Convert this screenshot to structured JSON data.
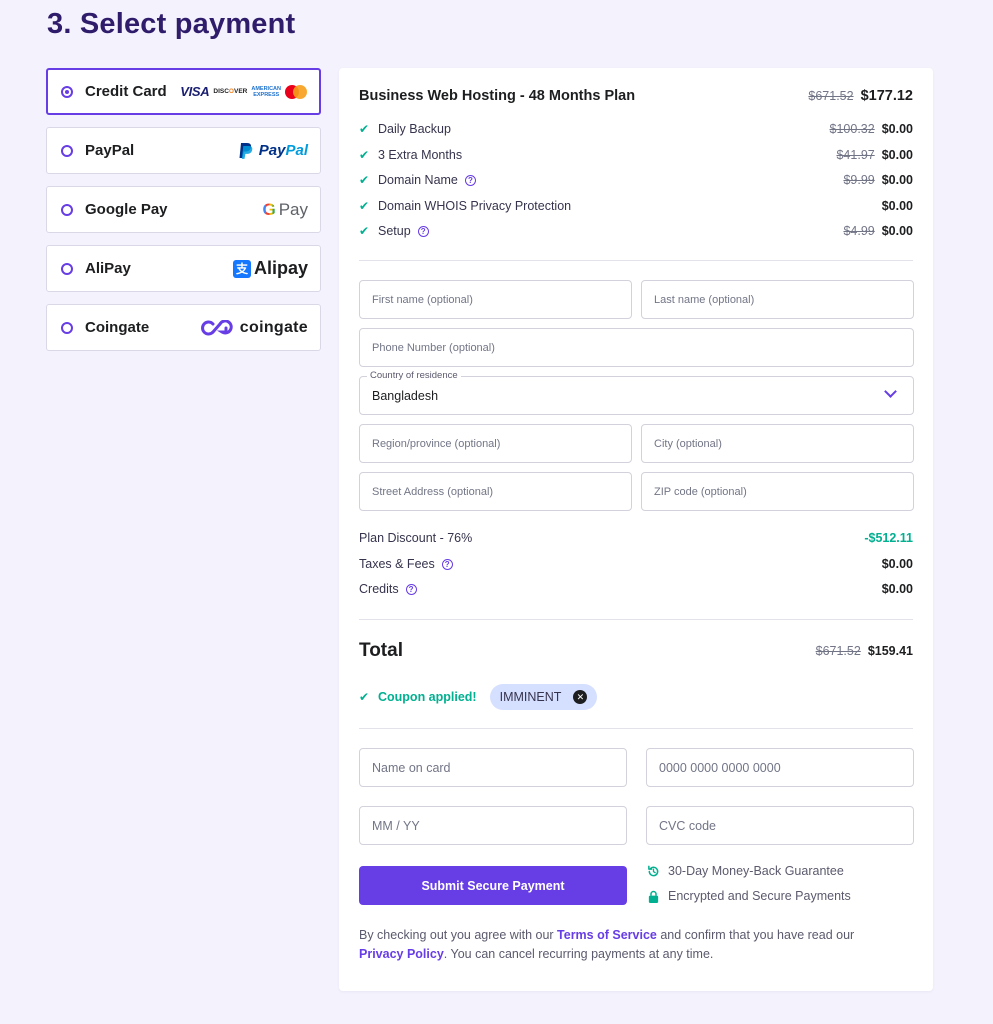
{
  "page": {
    "title": "3. Select payment"
  },
  "payment_methods": [
    {
      "label": "Credit Card",
      "selected": true,
      "logo": "card-brands"
    },
    {
      "label": "PayPal",
      "selected": false,
      "logo": "paypal-logo",
      "logo_text_a": "Pay",
      "logo_text_b": "Pal"
    },
    {
      "label": "Google Pay",
      "selected": false,
      "logo": "google-pay-logo",
      "logo_text_g": "G",
      "logo_text": "Pay"
    },
    {
      "label": "AliPay",
      "selected": false,
      "logo": "alipay-logo",
      "logo_mark": "支",
      "logo_text": "Alipay"
    },
    {
      "label": "Coingate",
      "selected": false,
      "logo": "coingate-logo",
      "logo_text": "coingate"
    }
  ],
  "card_brands": {
    "visa": "VISA",
    "discover_a": "DISC",
    "discover_o": "O",
    "discover_b": "VER",
    "amex_a": "AMERICAN",
    "amex_b": "EXPRESS"
  },
  "order": {
    "plan_title": "Business Web Hosting - 48 Months Plan",
    "plan_old_price": "$671.52",
    "plan_price": "$177.12",
    "features": [
      {
        "label": "Daily Backup",
        "old": "$100.32",
        "price": "$0.00",
        "help": false
      },
      {
        "label": "3 Extra Months",
        "old": "$41.97",
        "price": "$0.00",
        "help": false
      },
      {
        "label": "Domain Name",
        "old": "$9.99",
        "price": "$0.00",
        "help": true
      },
      {
        "label": "Domain WHOIS Privacy Protection",
        "old": "",
        "price": "$0.00",
        "help": false
      },
      {
        "label": "Setup",
        "old": "$4.99",
        "price": "$0.00",
        "help": true
      }
    ]
  },
  "form": {
    "first_name_placeholder": "First name (optional)",
    "last_name_placeholder": "Last name (optional)",
    "phone_placeholder": "Phone Number (optional)",
    "country_label": "Country of residence",
    "country_value": "Bangladesh",
    "region_placeholder": "Region/province (optional)",
    "city_placeholder": "City (optional)",
    "street_placeholder": "Street Address (optional)",
    "zip_placeholder": "ZIP code (optional)"
  },
  "summary": {
    "discount_label": "Plan Discount - 76%",
    "discount_value": "-$512.11",
    "taxes_label": "Taxes & Fees",
    "taxes_value": "$0.00",
    "credits_label": "Credits",
    "credits_value": "$0.00",
    "total_label": "Total",
    "total_old": "$671.52",
    "total_value": "$159.41"
  },
  "coupon": {
    "applied_text": "Coupon applied!",
    "code": "IMMINENT"
  },
  "card_form": {
    "name_placeholder": "Name on card",
    "number_placeholder": "0000 0000 0000 0000",
    "expiry_placeholder": "MM / YY",
    "cvc_placeholder": "CVC code"
  },
  "actions": {
    "submit_label": "Submit Secure Payment"
  },
  "guarantees": {
    "money_back": "30-Day Money-Back Guarantee",
    "secure": "Encrypted and Secure Payments"
  },
  "legal": {
    "text_1": "By checking out you agree with our ",
    "terms_link": "Terms of Service",
    "text_2": " and confirm that you have read our ",
    "privacy_link": "Privacy Policy",
    "text_3": ". You can cancel recurring payments at any time."
  },
  "colors": {
    "accent": "#673de6",
    "success": "#00b090",
    "heading": "#2f1c6a",
    "background": "#f4f3fd"
  }
}
